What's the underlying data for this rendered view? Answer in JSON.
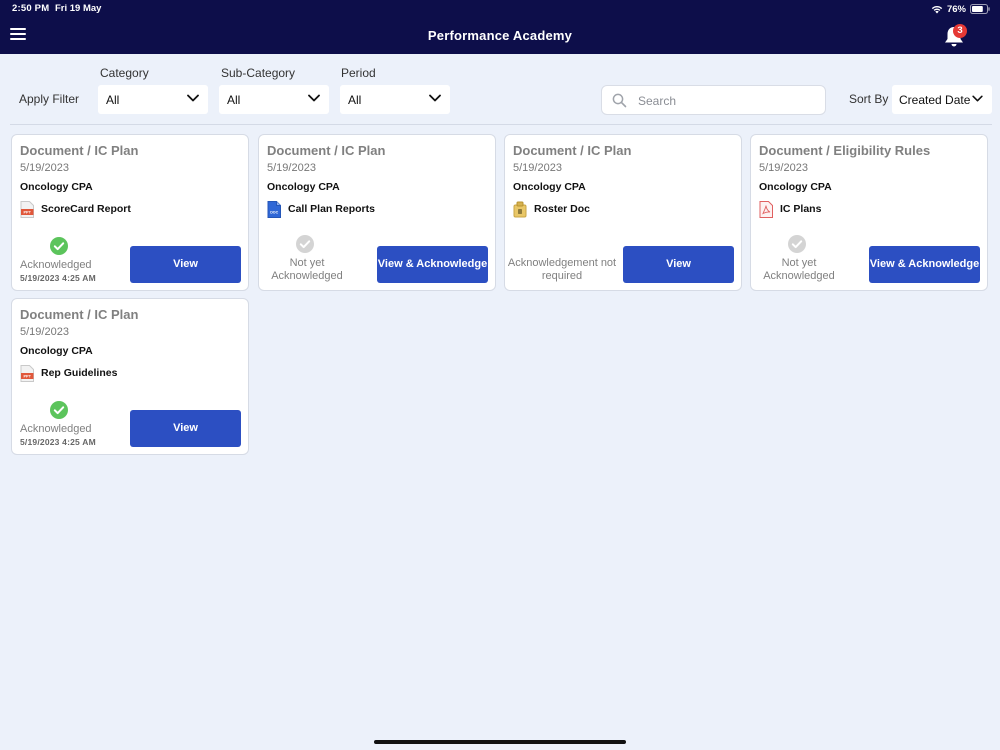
{
  "status_bar": {
    "time": "2:50 PM",
    "date": "Fri 19 May",
    "battery": "76%"
  },
  "header": {
    "title": "Performance Academy",
    "notification_count": "3",
    "icons": {
      "menu": "menu-icon",
      "bell": "bell-icon"
    }
  },
  "filters": {
    "apply_label": "Apply Filter",
    "category": {
      "label": "Category",
      "value": "All"
    },
    "sub_category": {
      "label": "Sub-Category",
      "value": "All"
    },
    "period": {
      "label": "Period",
      "value": "All"
    },
    "search_placeholder": "Search",
    "sort": {
      "label": "Sort By",
      "value": "Created Date"
    }
  },
  "colors": {
    "header_bg": "#0d0e4a",
    "button": "#2c4fc2",
    "success": "#5cc45c",
    "badge": "#e53935"
  },
  "cards": [
    {
      "title": "Document / IC Plan",
      "date": "5/19/2023",
      "product": "Oncology CPA",
      "file": {
        "name": "ScoreCard Report",
        "icon": "ppt-file-icon"
      },
      "status": {
        "state": "acknowledged",
        "text": "Acknowledged",
        "time": "5/19/2023 4:25 AM"
      },
      "button": "View"
    },
    {
      "title": "Document / IC Plan",
      "date": "5/19/2023",
      "product": "Oncology CPA",
      "file": {
        "name": "Call Plan Reports",
        "icon": "doc-file-icon"
      },
      "status": {
        "state": "pending",
        "text": "Not yet Acknowledged"
      },
      "button": "View & Acknowledge"
    },
    {
      "title": "Document / IC Plan",
      "date": "5/19/2023",
      "product": "Oncology CPA",
      "file": {
        "name": "Roster Doc",
        "icon": "zip-file-icon"
      },
      "status": {
        "state": "not-required",
        "text": "Acknowledgement not required"
      },
      "button": "View"
    },
    {
      "title": "Document / Eligibility Rules",
      "date": "5/19/2023",
      "product": "Oncology CPA",
      "file": {
        "name": "IC Plans",
        "icon": "pdf-file-icon"
      },
      "status": {
        "state": "pending",
        "text": "Not yet Acknowledged"
      },
      "button": "View & Acknowledge"
    },
    {
      "title": "Document / IC Plan",
      "date": "5/19/2023",
      "product": "Oncology CPA",
      "file": {
        "name": "Rep Guidelines",
        "icon": "ppt-file-icon"
      },
      "status": {
        "state": "acknowledged",
        "text": "Acknowledged",
        "time": "5/19/2023 4:25 AM"
      },
      "button": "View"
    }
  ]
}
